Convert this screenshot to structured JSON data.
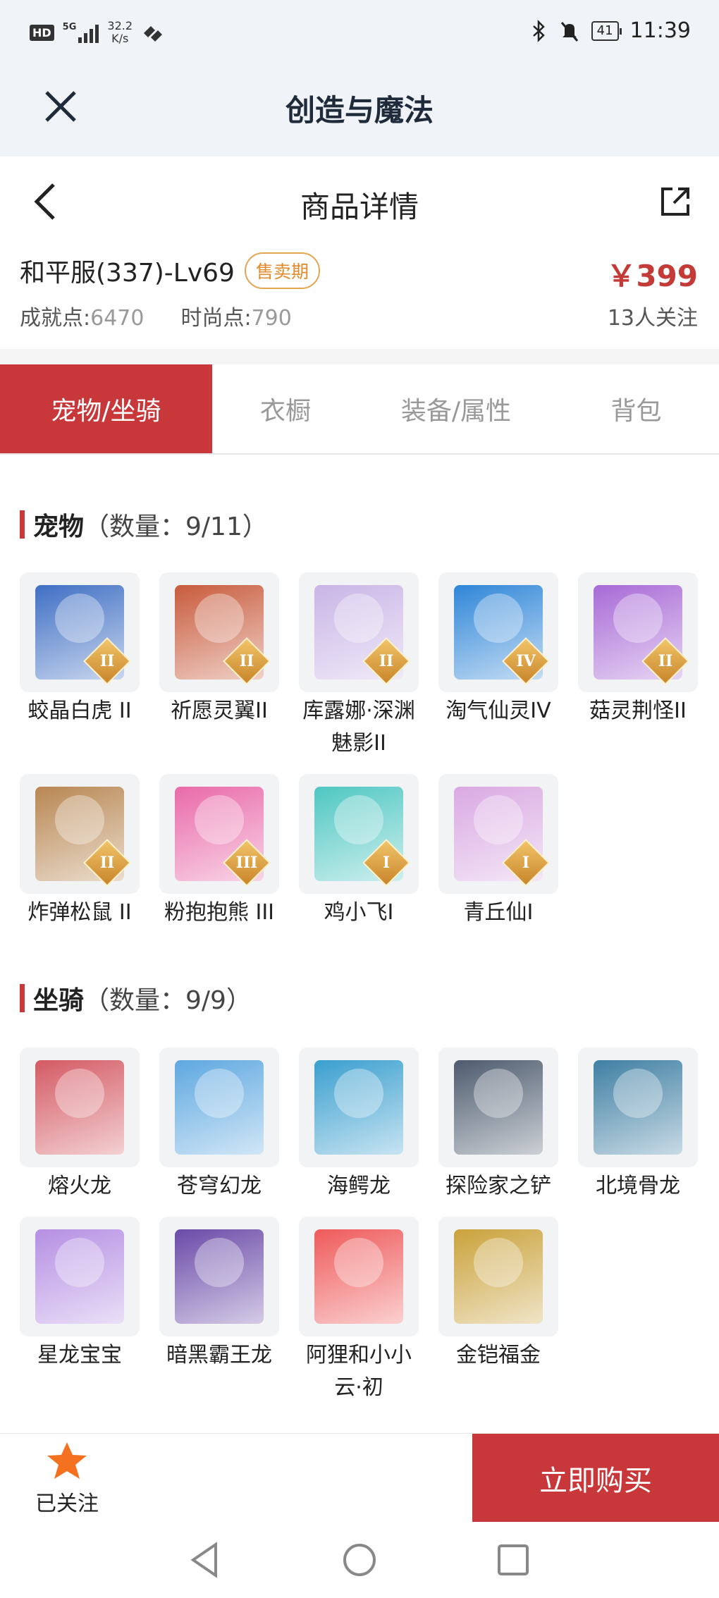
{
  "status": {
    "hd": "HD",
    "network": "5G",
    "speed_value": "32.2",
    "speed_unit": "K/s",
    "battery": "41",
    "time": "11:39"
  },
  "app": {
    "title": "创造与魔法"
  },
  "nav": {
    "title": "商品详情"
  },
  "product": {
    "name": "和平服(337)-Lv69",
    "badge": "售卖期",
    "price": "￥399",
    "achievement_label": "成就点:",
    "achievement_value": "6470",
    "fashion_label": "时尚点:",
    "fashion_value": "790",
    "followers": "13人关注"
  },
  "tabs": [
    "宠物/坐骑",
    "衣橱",
    "装备/属性",
    "背包"
  ],
  "pets": {
    "title": "宠物",
    "count": "（数量：9/11）",
    "items": [
      {
        "label": "蛟晶白虎 II",
        "level": "II",
        "color": "#3f6fc4"
      },
      {
        "label": "祈愿灵翼II",
        "level": "II",
        "color": "#c85b3c"
      },
      {
        "label": "库露娜·深渊魅影II",
        "level": "II",
        "color": "#c9b5e6"
      },
      {
        "label": "淘气仙灵IV",
        "level": "IV",
        "color": "#2f86d8"
      },
      {
        "label": "菇灵荆怪II",
        "level": "II",
        "color": "#a86ad6"
      },
      {
        "label": "炸弹松鼠 II",
        "level": "II",
        "color": "#b88752"
      },
      {
        "label": "粉抱抱熊 III",
        "level": "III",
        "color": "#e96aa9"
      },
      {
        "label": "鸡小飞I",
        "level": "I",
        "color": "#4fc7c2"
      },
      {
        "label": "青丘仙I",
        "level": "I",
        "color": "#d9a9e2"
      }
    ]
  },
  "mounts": {
    "title": "坐骑",
    "count": "（数量：9/9）",
    "items": [
      {
        "label": "熔火龙",
        "color": "#d45a63"
      },
      {
        "label": "苍穹幻龙",
        "color": "#5ea8e0"
      },
      {
        "label": "海鳄龙",
        "color": "#3a9fcf"
      },
      {
        "label": "探险家之铲",
        "color": "#4d5b6e"
      },
      {
        "label": "北境骨龙",
        "color": "#3f7fa3"
      },
      {
        "label": "星龙宝宝",
        "color": "#b58fe3"
      },
      {
        "label": "暗黑霸王龙",
        "color": "#6a4aa8"
      },
      {
        "label": "阿狸和小小云·初",
        "color": "#ef5a5a"
      },
      {
        "label": "金铠福金",
        "color": "#caa23b"
      }
    ]
  },
  "bottom": {
    "follow_label": "已关注",
    "buy_label": "立即购买"
  },
  "colors": {
    "accent": "#c8373a",
    "price": "#c33a37",
    "badge": "#e08a2c"
  }
}
